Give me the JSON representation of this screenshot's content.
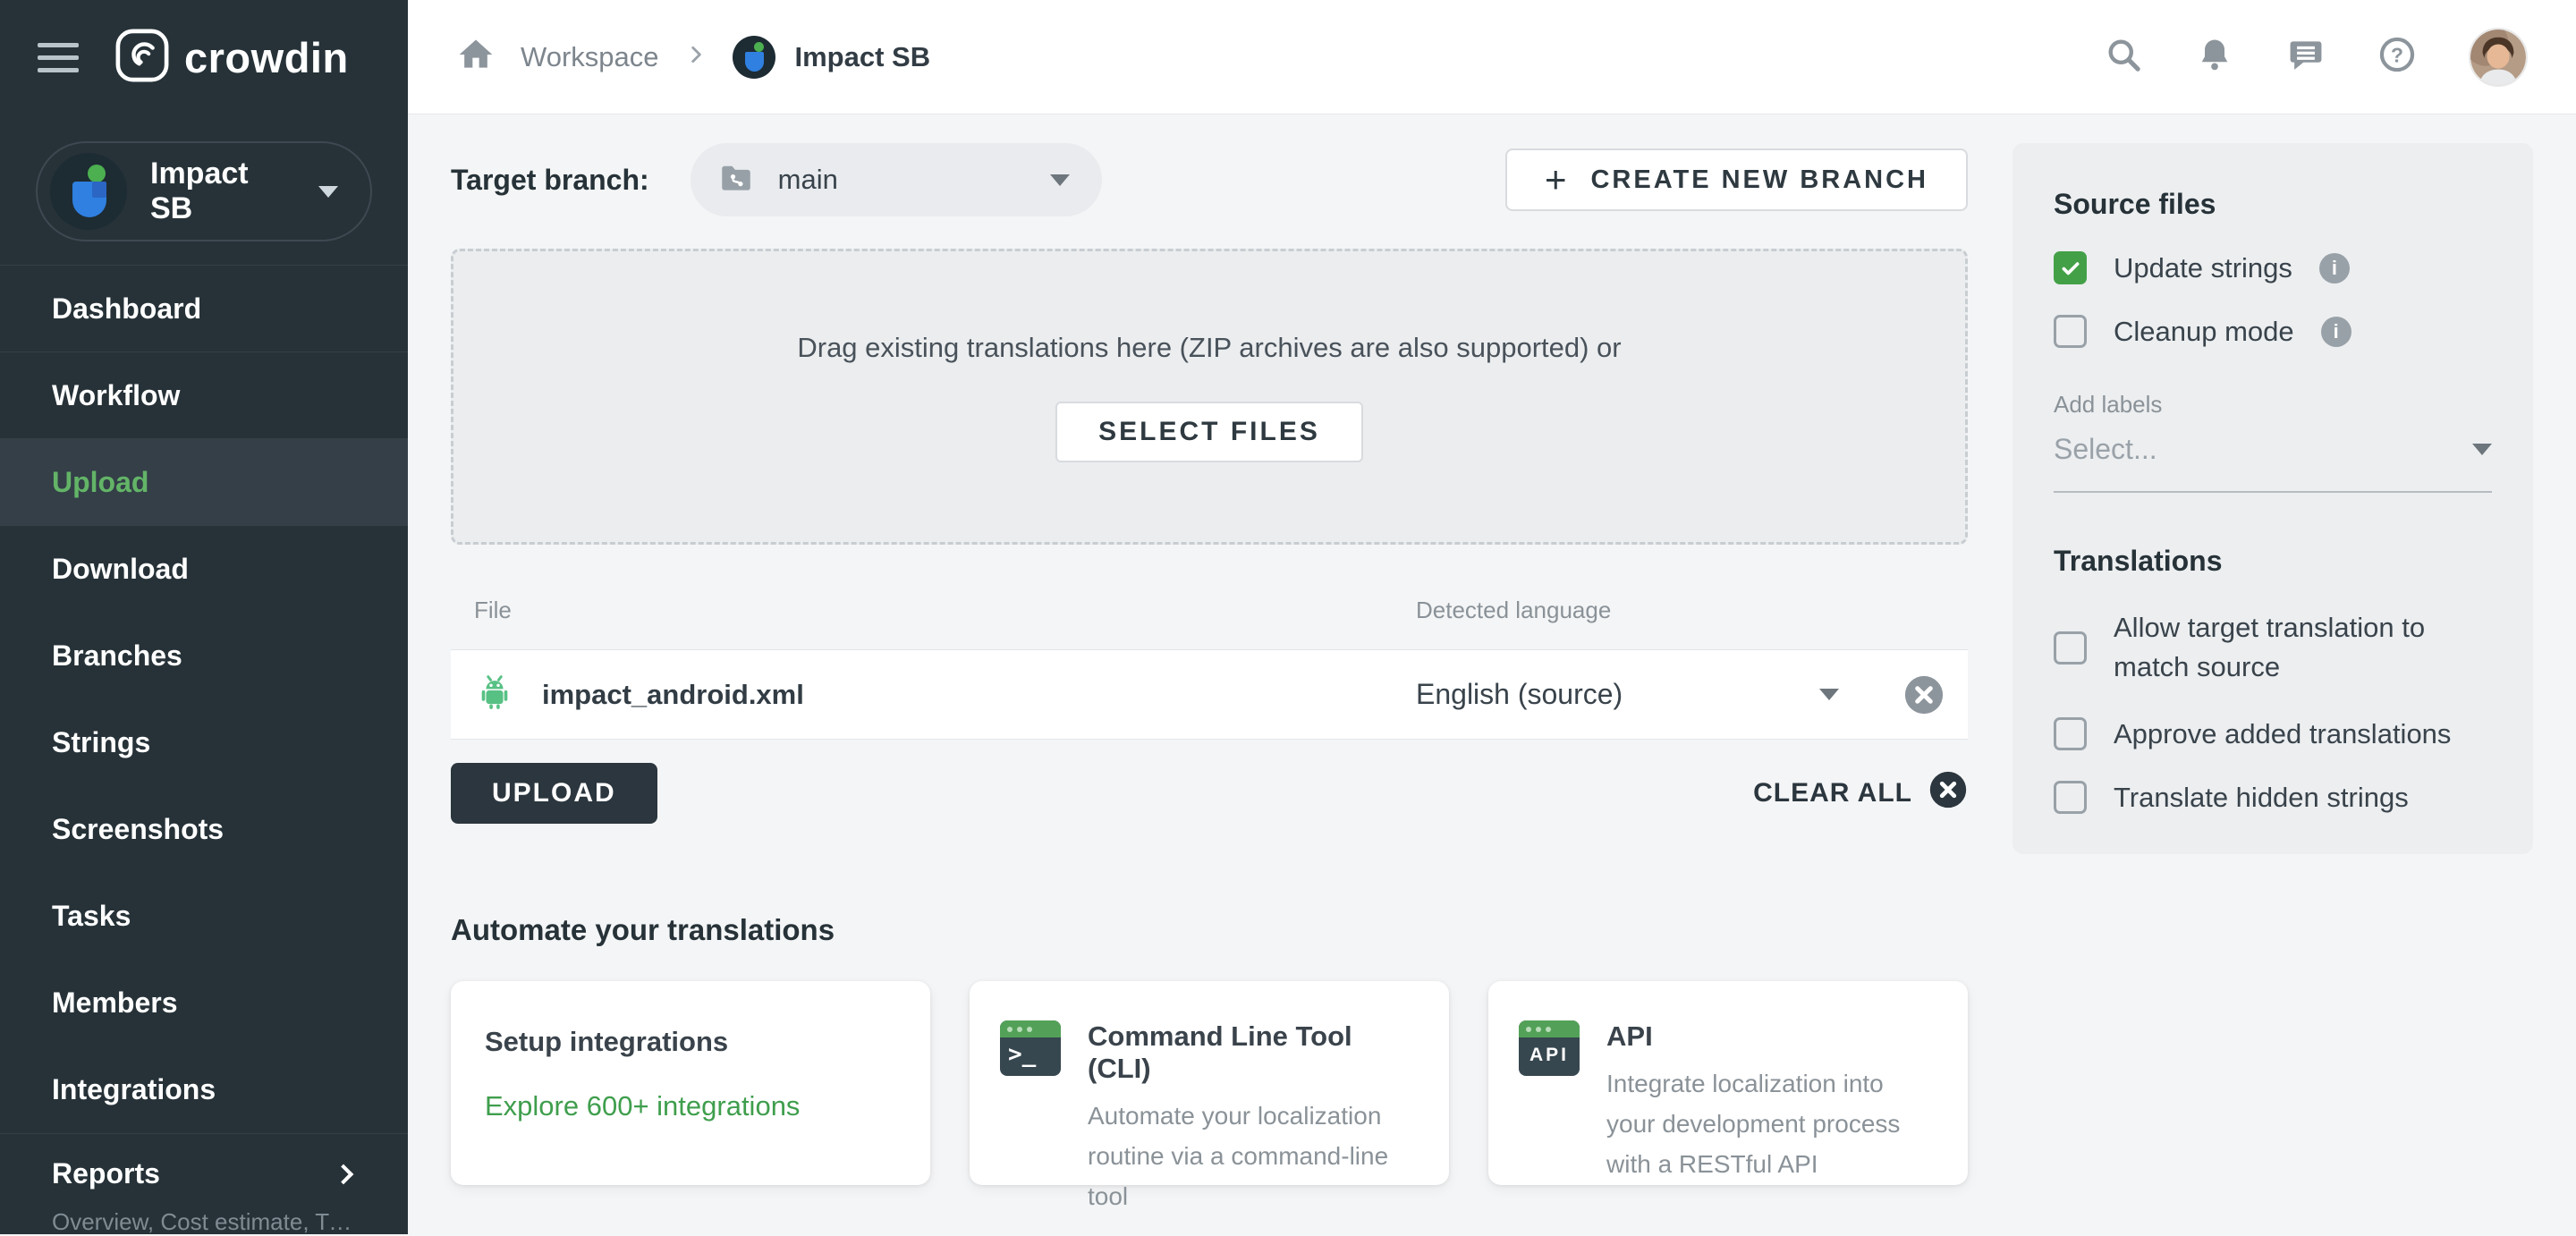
{
  "colors": {
    "sidebar_bg": "#263238",
    "active_green": "#63b467",
    "link_green": "#3f9e4d",
    "checkbox_green": "#43a047",
    "page_bg": "#f4f5f6",
    "panel_bg": "#eceef0",
    "dark_button": "#2b363e"
  },
  "sidebar": {
    "brand": "crowdin",
    "project_name": "Impact SB",
    "items": [
      {
        "label": "Dashboard"
      },
      {
        "label": "Workflow"
      },
      {
        "label": "Upload"
      },
      {
        "label": "Download"
      },
      {
        "label": "Branches"
      },
      {
        "label": "Strings"
      },
      {
        "label": "Screenshots"
      },
      {
        "label": "Tasks"
      },
      {
        "label": "Members"
      },
      {
        "label": "Integrations"
      }
    ],
    "reports": {
      "label": "Reports",
      "sublabel": "Overview, Cost estimate, Transl…"
    }
  },
  "topbar": {
    "breadcrumb": {
      "workspace": "Workspace",
      "project": "Impact SB"
    },
    "icons": [
      "search-icon",
      "bell-icon",
      "chat-icon",
      "help-icon",
      "user-avatar"
    ]
  },
  "branch_bar": {
    "label": "Target branch:",
    "selected_branch": "main",
    "create_button": "CREATE NEW BRANCH",
    "plus_glyph": "+"
  },
  "dropzone": {
    "hint": "Drag existing translations here (ZIP archives are also supported) or",
    "select_button": "SELECT FILES"
  },
  "files": {
    "columns": {
      "file": "File",
      "language": "Detected language"
    },
    "rows": [
      {
        "name": "impact_android.xml",
        "language": "English (source)",
        "type_icon": "android-icon"
      }
    ],
    "upload_button": "UPLOAD",
    "clear_all": "CLEAR ALL"
  },
  "automate": {
    "title": "Automate your translations",
    "cards": [
      {
        "title": "Setup integrations",
        "link": "Explore 600+ integrations"
      },
      {
        "title": "Command Line Tool (CLI)",
        "desc": "Automate your localization routine via a command-line tool",
        "icon_glyph": ">_"
      },
      {
        "title": "API",
        "desc": "Integrate localization into your development process with a RESTful API",
        "icon_glyph": "API"
      }
    ]
  },
  "panel": {
    "source_files": {
      "title": "Source files",
      "options": [
        {
          "label": "Update strings",
          "checked": true
        },
        {
          "label": "Cleanup mode",
          "checked": false
        }
      ]
    },
    "add_labels": {
      "label": "Add labels",
      "placeholder": "Select..."
    },
    "translations": {
      "title": "Translations",
      "options": [
        {
          "label": "Allow target translation to match source"
        },
        {
          "label": "Approve added translations"
        },
        {
          "label": "Translate hidden strings"
        }
      ]
    }
  }
}
